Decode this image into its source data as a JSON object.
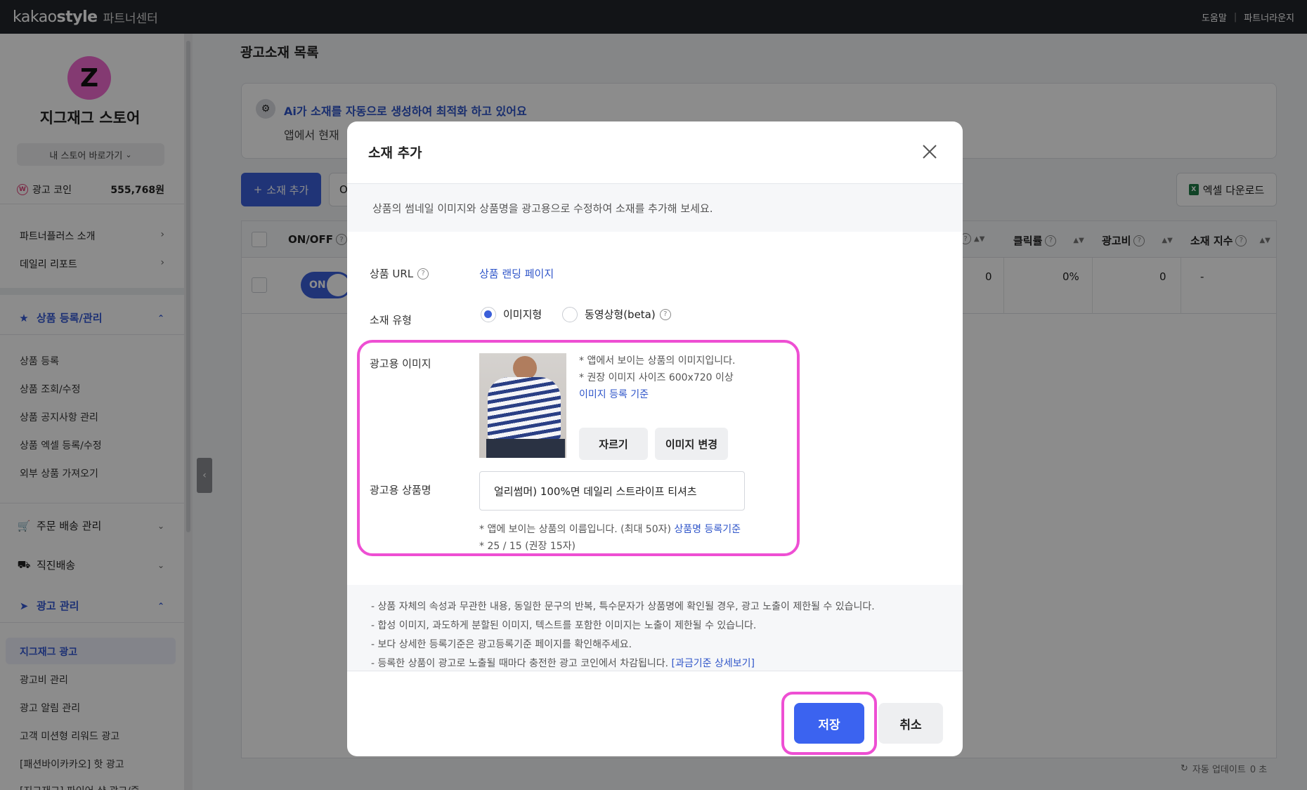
{
  "topbar": {
    "brand_light": "kakao",
    "brand_bold": "style",
    "brand_sub": "파트너센터",
    "links": [
      "도움말",
      "파트너라운지"
    ],
    "separator": "|"
  },
  "sidebar": {
    "store_initial": "Z",
    "store_name": "지그재그 스토어",
    "goto_label": "내 스토어 바로가기",
    "coin_icon": "W",
    "coin_label": "광고 코인",
    "coin_value": "555,768원",
    "links": [
      "파트너플러스 소개",
      "데일리 리포트"
    ],
    "sections": {
      "product": {
        "label": "상품 등록/관리",
        "items": [
          "상품 등록",
          "상품 조회/수정",
          "상품 공지사항 관리",
          "상품 엑셀 등록/수정",
          "외부 상품 가져오기"
        ]
      },
      "order": {
        "label": "주문 배송 관리"
      },
      "direct": {
        "label": "직진배송"
      },
      "ads": {
        "label": "광고 관리",
        "items": [
          "지그재그 광고",
          "광고비 관리",
          "광고 알림 관리",
          "고객 미션형 리워드 광고",
          "[패션바이카카오] 핫 광고",
          "[지그재그] 파이어 샷 광고/중"
        ]
      }
    }
  },
  "main": {
    "title": "광고소재 목록",
    "ai_title": "Ai가 소재를 자동으로 생성하여 최적화 하고 있어요",
    "ai_desc": "앱에서 현재",
    "add_button": "소재 추가",
    "add_plus": "+",
    "partial_button": "O",
    "excel_button": "엑셀 다운로드",
    "excel_icon": "X",
    "table": {
      "headers": {
        "onoff": "ON/OFF",
        "ctr": "클릭률",
        "cost": "광고비",
        "index": "소재 지수"
      },
      "row": {
        "toggle": "ON",
        "col_a": "0",
        "ctr": "0%",
        "cost": "0",
        "index": "-"
      }
    },
    "auto_update": "자동 업데이트",
    "auto_update_value": "0 초"
  },
  "modal": {
    "title": "소재 추가",
    "intro": "상품의 썸네일 이미지와 상품명을 광고용으로 수정하여 소재를 추가해 보세요.",
    "url_label": "상품 URL",
    "url_link": "상품 랜딩 페이지",
    "type_label": "소재 유형",
    "type_options": [
      "이미지형",
      "동영상형(beta)"
    ],
    "type_selected": "이미지형",
    "image_label": "광고용 이미지",
    "image_notes": [
      "* 앱에서 보이는 상품의 이미지입니다.",
      "* 권장 이미지 사이즈 600x720 이상"
    ],
    "image_guide_link": "이미지 등록 기준",
    "crop_button": "자르기",
    "change_button": "이미지 변경",
    "name_label": "광고용 상품명",
    "name_value": "얼리썸머) 100%면 데일리 스트라이프 티셔츠",
    "name_note": "* 앱에 보이는 상품의 이름입니다. (최대 50자)",
    "name_guide_link": "상품명 등록기준",
    "name_count": "* 25 / 15 (권장 15자)",
    "notices": [
      "- 상품 자체의 속성과 무관한 내용, 동일한 문구의 반복, 특수문자가 상품명에 확인될 경우, 광고 노출이 제한될 수 있습니다.",
      "- 합성 이미지, 과도하게 분할된 이미지, 텍스트를 포함한 이미지는 노출이 제한될 수 있습니다.",
      "- 보다 상세한 등록기준은 광고등록기준 페이지를 확인해주세요."
    ],
    "notice_last": "- 등록한 상품이 광고로 노출될 때마다 충전한 광고 코인에서 차감됩니다.",
    "notice_last_link": "[과금기준 상세보기]",
    "save_button": "저장",
    "cancel_button": "취소"
  },
  "colors": {
    "accent": "#3b5fd9",
    "highlight": "#ee4fd3",
    "topbar": "#22252b",
    "avatar": "#f06bd0"
  }
}
